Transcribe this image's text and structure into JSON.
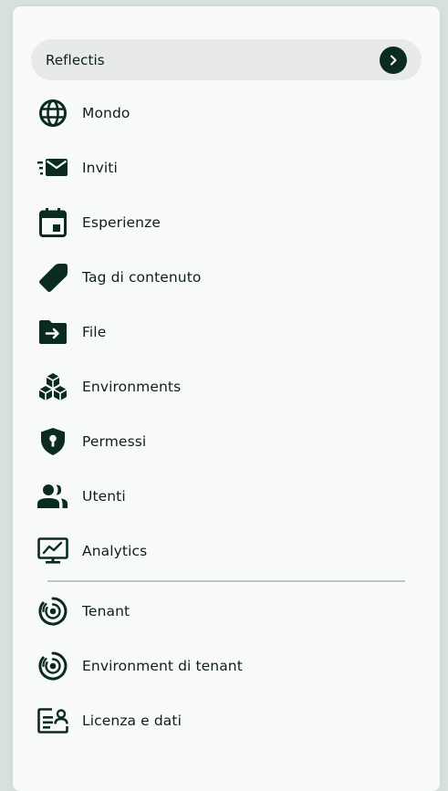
{
  "theme": {
    "icon_color": "#0a2a22",
    "header_bg": "#e8e9eb",
    "panel_bg": "#f8faf9"
  },
  "header": {
    "label": "Reflectis",
    "button_icon": "chevron-right-icon"
  },
  "menu": [
    {
      "label": "Mondo",
      "icon": "globe-icon"
    },
    {
      "label": "Inviti",
      "icon": "email-fast-icon"
    },
    {
      "label": "Esperienze",
      "icon": "calendar-icon"
    },
    {
      "label": "Tag di contenuto",
      "icon": "tag-icon"
    },
    {
      "label": "File",
      "icon": "folder-move-icon"
    },
    {
      "label": "Environments",
      "icon": "cubes-icon"
    },
    {
      "label": "Permessi",
      "icon": "shield-key-icon"
    },
    {
      "label": "Utenti",
      "icon": "users-icon"
    },
    {
      "label": "Analytics",
      "icon": "monitor-chart-icon"
    }
  ],
  "secondary_menu": [
    {
      "label": "Tenant",
      "icon": "target-ring-icon"
    },
    {
      "label": "Environment di tenant",
      "icon": "target-ring-icon"
    },
    {
      "label": "Licenza e dati",
      "icon": "license-card-icon"
    }
  ]
}
